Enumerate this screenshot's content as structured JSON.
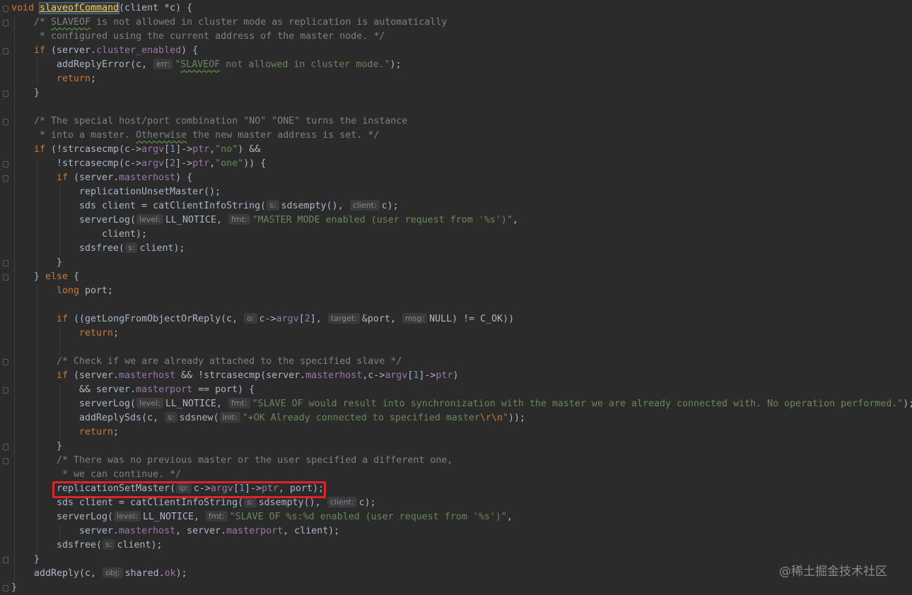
{
  "editor": {
    "lines": [
      {
        "indent": 0,
        "tokens": [
          {
            "c": "kw",
            "t": "void "
          },
          {
            "c": "hl-name",
            "t": "slaveofCommand"
          },
          {
            "t": "(client *c) {"
          }
        ]
      },
      {
        "indent": 1,
        "tokens": [
          {
            "c": "cmt",
            "t": "/* "
          },
          {
            "c": "cmt typo",
            "t": "SLAVEOF"
          },
          {
            "c": "cmt",
            "t": " is not allowed in cluster mode as replication is automatically"
          }
        ]
      },
      {
        "indent": 1,
        "tokens": [
          {
            "c": "cmt",
            "t": " * configured using the current address of the master node. */"
          }
        ]
      },
      {
        "indent": 1,
        "tokens": [
          {
            "c": "kw",
            "t": "if "
          },
          {
            "t": "(server."
          },
          {
            "c": "field",
            "t": "cluster_enabled"
          },
          {
            "t": ") {"
          }
        ]
      },
      {
        "indent": 2,
        "tokens": [
          {
            "t": "addReplyError(c, "
          },
          {
            "hint": "err:"
          },
          {
            "c": "str",
            "t": "\""
          },
          {
            "c": "str typo",
            "t": "SLAVEOF"
          },
          {
            "c": "str",
            "t": " not allowed in cluster mode.\""
          },
          {
            "t": ");"
          }
        ]
      },
      {
        "indent": 2,
        "tokens": [
          {
            "c": "kw",
            "t": "return"
          },
          {
            "t": ";"
          }
        ]
      },
      {
        "indent": 1,
        "tokens": [
          {
            "t": "}"
          }
        ]
      },
      {
        "indent": 0,
        "tokens": []
      },
      {
        "indent": 1,
        "tokens": [
          {
            "c": "cmt",
            "t": "/* The special host/port combination \"NO\" \"ONE\" turns the instance"
          }
        ]
      },
      {
        "indent": 1,
        "tokens": [
          {
            "c": "cmt",
            "t": " * into a master. "
          },
          {
            "c": "cmt typo",
            "t": "Otherwise"
          },
          {
            "c": "cmt",
            "t": " the new master address is set. */"
          }
        ]
      },
      {
        "indent": 1,
        "tokens": [
          {
            "c": "kw",
            "t": "if "
          },
          {
            "t": "(!strcasecmp(c->"
          },
          {
            "c": "field",
            "t": "argv"
          },
          {
            "t": "["
          },
          {
            "c": "num",
            "t": "1"
          },
          {
            "t": "]->"
          },
          {
            "c": "field",
            "t": "ptr"
          },
          {
            "t": ","
          },
          {
            "c": "str",
            "t": "\"no\""
          },
          {
            "t": ") &&"
          }
        ]
      },
      {
        "indent": 2,
        "tokens": [
          {
            "t": "!strcasecmp(c->"
          },
          {
            "c": "field",
            "t": "argv"
          },
          {
            "t": "["
          },
          {
            "c": "num",
            "t": "2"
          },
          {
            "t": "]->"
          },
          {
            "c": "field",
            "t": "ptr"
          },
          {
            "t": ","
          },
          {
            "c": "str",
            "t": "\"one\""
          },
          {
            "t": ")) {"
          }
        ]
      },
      {
        "indent": 2,
        "tokens": [
          {
            "c": "kw",
            "t": "if "
          },
          {
            "t": "(server."
          },
          {
            "c": "field",
            "t": "masterhost"
          },
          {
            "t": ") {"
          }
        ]
      },
      {
        "indent": 3,
        "tokens": [
          {
            "t": "replicationUnsetMaster();"
          }
        ]
      },
      {
        "indent": 3,
        "tokens": [
          {
            "t": "sds client = catClientInfoString("
          },
          {
            "hint": "s:"
          },
          {
            "t": "sdsempty(), "
          },
          {
            "hint": "client:"
          },
          {
            "t": "c);"
          }
        ]
      },
      {
        "indent": 3,
        "tokens": [
          {
            "t": "serverLog("
          },
          {
            "hint": "level:"
          },
          {
            "t": "LL_NOTICE, "
          },
          {
            "hint": "fmt:"
          },
          {
            "c": "str",
            "t": "\"MASTER MODE enabled (user request from '%s')\""
          },
          {
            "t": ","
          }
        ]
      },
      {
        "indent": 4,
        "tokens": [
          {
            "t": "client);"
          }
        ]
      },
      {
        "indent": 3,
        "tokens": [
          {
            "t": "sdsfree("
          },
          {
            "hint": "s:"
          },
          {
            "t": "client);"
          }
        ]
      },
      {
        "indent": 2,
        "tokens": [
          {
            "t": "}"
          }
        ]
      },
      {
        "indent": 1,
        "tokens": [
          {
            "t": "} "
          },
          {
            "c": "kw",
            "t": "else"
          },
          {
            "t": " {"
          }
        ]
      },
      {
        "indent": 2,
        "tokens": [
          {
            "c": "kw",
            "t": "long"
          },
          {
            "t": " port;"
          }
        ]
      },
      {
        "indent": 0,
        "tokens": []
      },
      {
        "indent": 2,
        "tokens": [
          {
            "c": "kw",
            "t": "if "
          },
          {
            "t": "((getLongFromObjectOrReply(c, "
          },
          {
            "hint": "o:"
          },
          {
            "t": "c->"
          },
          {
            "c": "field",
            "t": "argv"
          },
          {
            "t": "["
          },
          {
            "c": "num",
            "t": "2"
          },
          {
            "t": "], "
          },
          {
            "hint": "target:"
          },
          {
            "t": "&port, "
          },
          {
            "hint": "msg:"
          },
          {
            "t": "NULL) != C_OK))"
          }
        ]
      },
      {
        "indent": 3,
        "tokens": [
          {
            "c": "kw",
            "t": "return"
          },
          {
            "t": ";"
          }
        ]
      },
      {
        "indent": 0,
        "tokens": []
      },
      {
        "indent": 2,
        "tokens": [
          {
            "c": "cmt",
            "t": "/* Check if we are already attached to the specified slave */"
          }
        ]
      },
      {
        "indent": 2,
        "tokens": [
          {
            "c": "kw",
            "t": "if "
          },
          {
            "t": "(server."
          },
          {
            "c": "field",
            "t": "masterhost"
          },
          {
            "t": " && !strcasecmp(server."
          },
          {
            "c": "field",
            "t": "masterhost"
          },
          {
            "t": ",c->"
          },
          {
            "c": "field",
            "t": "argv"
          },
          {
            "t": "["
          },
          {
            "c": "num",
            "t": "1"
          },
          {
            "t": "]->"
          },
          {
            "c": "field",
            "t": "ptr"
          },
          {
            "t": ")"
          }
        ]
      },
      {
        "indent": 3,
        "tokens": [
          {
            "t": "&& server."
          },
          {
            "c": "field",
            "t": "masterport"
          },
          {
            "t": " == port) {"
          }
        ]
      },
      {
        "indent": 3,
        "tokens": [
          {
            "t": "serverLog("
          },
          {
            "hint": "level:"
          },
          {
            "t": "LL_NOTICE, "
          },
          {
            "hint": "fmt:"
          },
          {
            "c": "str",
            "t": "\"SLAVE OF would result into synchronization with the master we are already connected with. No operation performed.\""
          },
          {
            "t": ");"
          }
        ]
      },
      {
        "indent": 3,
        "tokens": [
          {
            "t": "addReplySds(c, "
          },
          {
            "hint": "s:"
          },
          {
            "t": "sdsnew("
          },
          {
            "hint": "init:"
          },
          {
            "c": "str",
            "t": "\"+OK Already connected to specified master"
          },
          {
            "c": "esc",
            "t": "\\r\\n"
          },
          {
            "c": "str",
            "t": "\""
          },
          {
            "t": "));"
          }
        ]
      },
      {
        "indent": 3,
        "tokens": [
          {
            "c": "kw",
            "t": "return"
          },
          {
            "t": ";"
          }
        ]
      },
      {
        "indent": 2,
        "tokens": [
          {
            "t": "}"
          }
        ]
      },
      {
        "indent": 2,
        "tokens": [
          {
            "c": "cmt",
            "t": "/* There was no previous master or the user specified a different one,"
          }
        ]
      },
      {
        "indent": 2,
        "tokens": [
          {
            "c": "cmt",
            "t": " * we can continue. */"
          }
        ]
      },
      {
        "indent": 2,
        "tokens": [
          {
            "t": "replicationSetMaster("
          },
          {
            "hint": "ip:"
          },
          {
            "t": "c->"
          },
          {
            "c": "field",
            "t": "argv"
          },
          {
            "t": "["
          },
          {
            "c": "num",
            "t": "1"
          },
          {
            "t": "]->"
          },
          {
            "c": "field",
            "t": "ptr"
          },
          {
            "t": ", port);"
          }
        ]
      },
      {
        "indent": 2,
        "tokens": [
          {
            "t": "sds client = catClientInfoString("
          },
          {
            "hint": "s:"
          },
          {
            "t": "sdsempty(), "
          },
          {
            "hint": "client:"
          },
          {
            "t": "c);"
          }
        ]
      },
      {
        "indent": 2,
        "tokens": [
          {
            "t": "serverLog("
          },
          {
            "hint": "level:"
          },
          {
            "t": "LL_NOTICE, "
          },
          {
            "hint": "fmt:"
          },
          {
            "c": "str",
            "t": "\"SLAVE OF %s:%d enabled (user request from '%s')\""
          },
          {
            "t": ","
          }
        ]
      },
      {
        "indent": 3,
        "tokens": [
          {
            "t": "server."
          },
          {
            "c": "field",
            "t": "masterhost"
          },
          {
            "t": ", server."
          },
          {
            "c": "field",
            "t": "masterport"
          },
          {
            "t": ", client);"
          }
        ]
      },
      {
        "indent": 2,
        "tokens": [
          {
            "t": "sdsfree("
          },
          {
            "hint": "s:"
          },
          {
            "t": "client);"
          }
        ]
      },
      {
        "indent": 1,
        "tokens": [
          {
            "t": "}"
          }
        ]
      },
      {
        "indent": 1,
        "tokens": [
          {
            "t": "addReply(c, "
          },
          {
            "hint": "obj:"
          },
          {
            "t": "shared."
          },
          {
            "c": "field",
            "t": "ok"
          },
          {
            "t": ");"
          }
        ]
      },
      {
        "indent": 0,
        "tokens": [
          {
            "t": "}"
          }
        ]
      }
    ],
    "highlighted_line": 34
  },
  "watermark": "@稀土掘金技术社区"
}
